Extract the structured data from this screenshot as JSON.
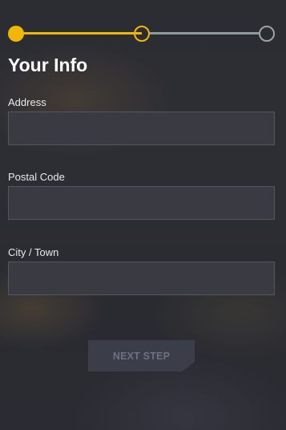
{
  "title": "Your Info",
  "stepper": {
    "current_step": 2,
    "total_steps": 3,
    "accent_color": "#f2b705",
    "inactive_color": "#8d9aa0"
  },
  "fields": [
    {
      "label": "Address",
      "value": "",
      "placeholder": ""
    },
    {
      "label": "Postal Code",
      "value": "",
      "placeholder": ""
    },
    {
      "label": "City / Town",
      "value": "",
      "placeholder": ""
    }
  ],
  "next_button": {
    "label": "NEXT STEP"
  }
}
